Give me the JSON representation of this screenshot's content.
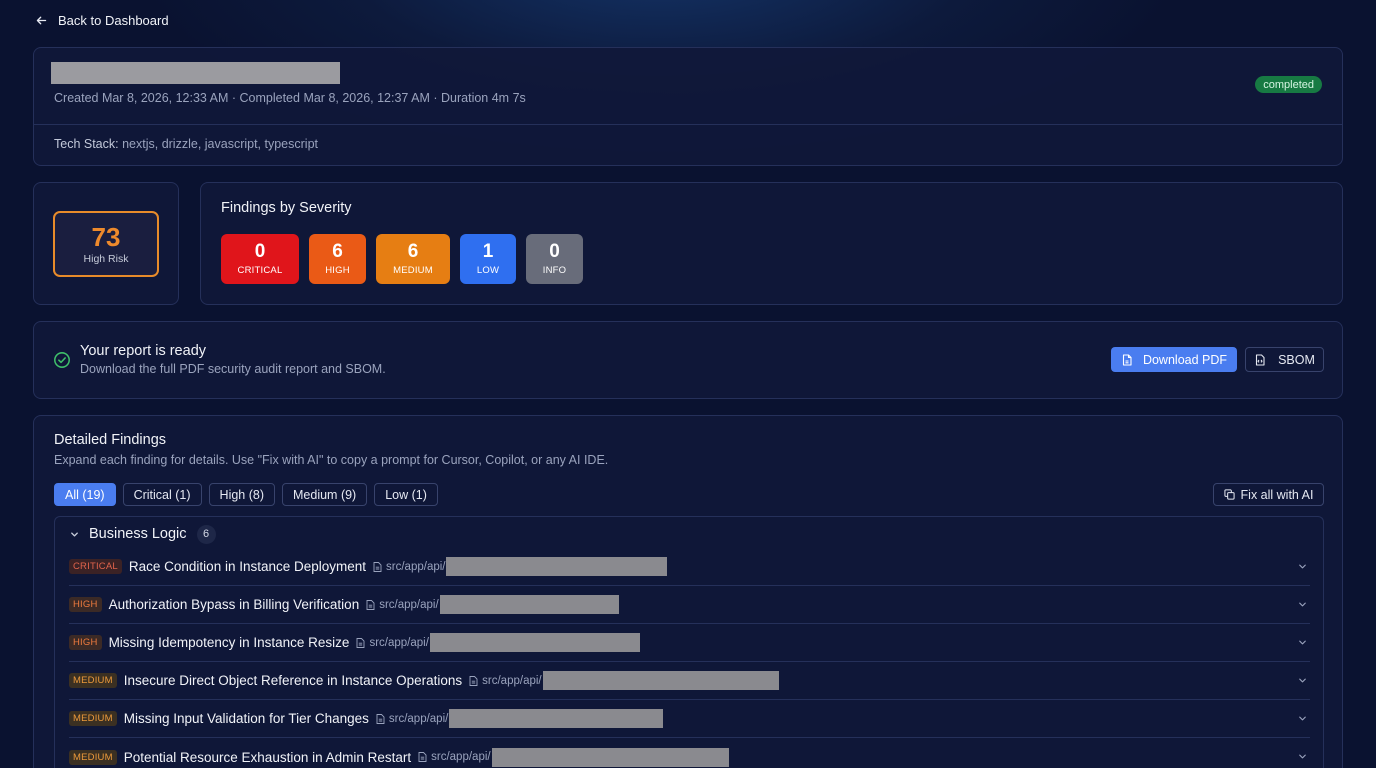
{
  "nav": {
    "back_label": "Back to Dashboard"
  },
  "scan": {
    "meta": "Created Mar 8, 2026, 12:33 AM · Completed Mar 8, 2026, 12:37 AM · Duration 4m 7s",
    "status": "completed",
    "tech_label": "Tech Stack:",
    "tech_value": " nextjs, drizzle, javascript, typescript"
  },
  "score": {
    "value": "73",
    "label": "High Risk",
    "color": "#ee8a2c"
  },
  "severity": {
    "title": "Findings by Severity",
    "items": [
      {
        "count": "0",
        "label": "CRITICAL",
        "color": "#e0151b"
      },
      {
        "count": "6",
        "label": "HIGH",
        "color": "#ea5a16"
      },
      {
        "count": "6",
        "label": "MEDIUM",
        "color": "#e67e13"
      },
      {
        "count": "1",
        "label": "LOW",
        "color": "#2f6ff0"
      },
      {
        "count": "0",
        "label": "INFO",
        "color": "#686c7a"
      }
    ]
  },
  "report": {
    "title": "Your report is ready",
    "subtitle": "Download the full PDF security audit report and SBOM.",
    "download_label": "Download PDF",
    "sbom_label": "SBOM"
  },
  "findings": {
    "title": "Detailed Findings",
    "subtitle": "Expand each finding for details. Use \"Fix with AI\" to copy a prompt for Cursor, Copilot, or any AI IDE.",
    "tabs": [
      "All (19)",
      "Critical (1)",
      "High (8)",
      "Medium (9)",
      "Low (1)"
    ],
    "fix_all_label": "Fix all with AI",
    "group": {
      "name": "Business Logic",
      "count": "6",
      "rows": [
        {
          "severity": "CRITICAL",
          "title": "Race Condition in Instance Deployment",
          "path": "src/app/api/"
        },
        {
          "severity": "HIGH",
          "title": "Authorization Bypass in Billing Verification",
          "path": "src/app/api/"
        },
        {
          "severity": "HIGH",
          "title": "Missing Idempotency in Instance Resize",
          "path": "src/app/api/"
        },
        {
          "severity": "MEDIUM",
          "title": "Insecure Direct Object Reference in Instance Operations",
          "path": "src/app/api/"
        },
        {
          "severity": "MEDIUM",
          "title": "Missing Input Validation for Tier Changes",
          "path": "src/app/api/"
        },
        {
          "severity": "MEDIUM",
          "title": "Potential Resource Exhaustion in Admin Restart",
          "path": "src/app/api/"
        }
      ]
    }
  }
}
